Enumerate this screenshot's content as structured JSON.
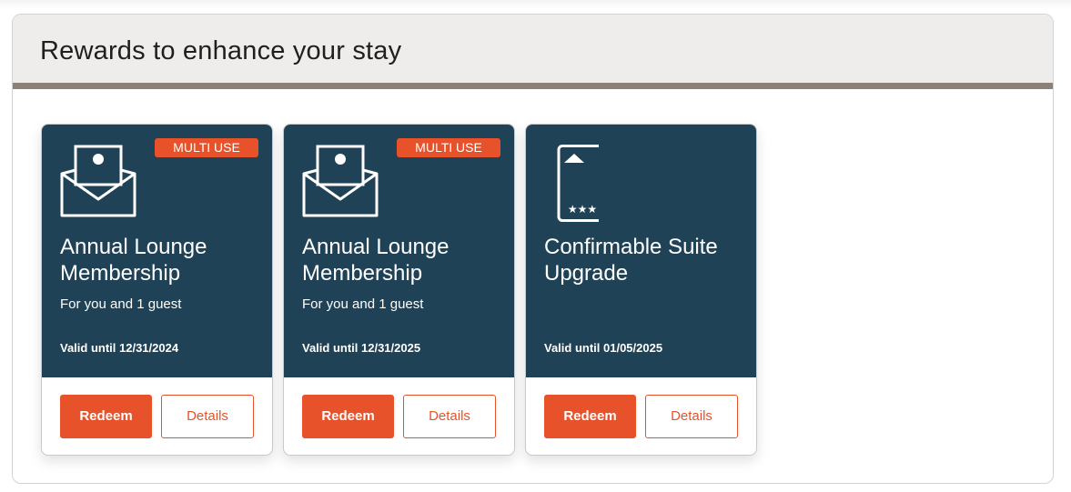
{
  "section": {
    "title": "Rewards to enhance your stay"
  },
  "colors": {
    "card_background": "#1f4256",
    "accent": "#e8522a",
    "header_background": "#efedeb",
    "header_border": "#8b8177"
  },
  "rewards": [
    {
      "badge": "MULTI USE",
      "icon": "envelope-ticket-icon",
      "title": "Annual Lounge Membership",
      "subtitle": "For you and 1 guest",
      "valid": "Valid until 12/31/2024",
      "redeem_label": "Redeem",
      "details_label": "Details"
    },
    {
      "badge": "MULTI USE",
      "icon": "envelope-ticket-icon",
      "title": "Annual Lounge Membership",
      "subtitle": "For you and 1 guest",
      "valid": "Valid until 12/31/2025",
      "redeem_label": "Redeem",
      "details_label": "Details"
    },
    {
      "badge": "",
      "icon": "room-key-card-icon",
      "title": "Confirmable Suite Upgrade",
      "subtitle": "",
      "valid": "Valid until 01/05/2025",
      "redeem_label": "Redeem",
      "details_label": "Details"
    }
  ]
}
